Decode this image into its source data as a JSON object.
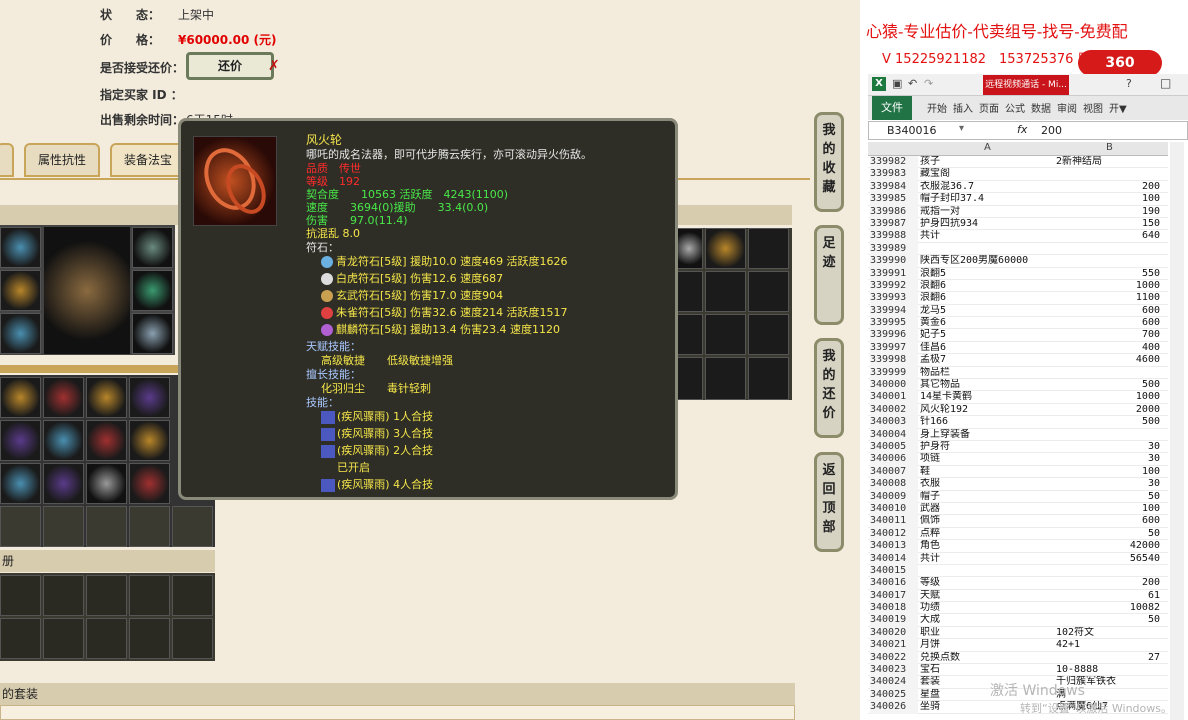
{
  "listing": {
    "status_label": "状　　态：",
    "status_value": "上架中",
    "price_label": "价　　格：",
    "price_value": "¥60000.00 (元)",
    "haggle_label": "是否接受还价：",
    "haggle_button": "还价",
    "buyer_label": "指定买家 ID ：",
    "remaining_label": "出售剩余时间：",
    "remaining_value": "6天15时"
  },
  "tabs": [
    "属性抗性",
    "装备法宝"
  ],
  "section_labels": {
    "s1": "册",
    "s2": "的套装"
  },
  "tooltip": {
    "name": "风火轮",
    "desc": "哪吒的成名法器，即可代步腾云疾行，亦可滚动异火伤敌。",
    "quality": "品质　传世",
    "level": "等级　192",
    "stat1": "契合度　　10563 活跃度　4243(1100)",
    "stat2": "速度　　3694(0)援助　　33.4(0.0)",
    "stat3": "伤害　　97.0(11.4)",
    "stat4": "抗混乱 8.0",
    "runes_label": "符石：",
    "runes": [
      "青龙符石[5级] 援助10.0 速度469 活跃度1626",
      "白虎符石[5级] 伤害12.6 速度687",
      "玄武符石[5级] 伤害17.0 速度904",
      "朱雀符石[5级] 伤害32.6 速度214 活跃度1517",
      "麒麟符石[5级] 援助13.4 伤害23.4 速度1120"
    ],
    "talent_label": "天赋技能：",
    "talent_values": "高级敏捷　　低级敏捷增强",
    "specialty_label": "擅长技能：",
    "specialty_values": "化羽归尘　　毒针轻刺",
    "skills_label": "技能：",
    "skills": [
      "(疾风骤雨) 1人合技",
      "(疾风骤雨) 3人合技",
      "(疾风骤雨) 2人合技",
      "已开启",
      "(疾风骤雨) 4人合技"
    ]
  },
  "side_buttons": [
    "我的收藏",
    "足迹",
    "我的还价",
    "返回顶部"
  ],
  "banner": {
    "line1": "心猿-专业估价-代卖组号-找号-免费配",
    "line2": "V 15225921182　153725376 朋友区组号"
  },
  "excel": {
    "file_menu": "文件",
    "ribbon_tabs": [
      "开始",
      "插入",
      "页面",
      "公式",
      "数据",
      "审阅",
      "视图",
      "开▼"
    ],
    "cell_ref": "B340016",
    "fx": "fx",
    "formula_value": "200",
    "col_a": "A",
    "col_b": "B",
    "window_tab": "远程视频通话 - Mi...",
    "logo": "360",
    "rows": [
      [
        "339982",
        "孩子",
        "2新神结局"
      ],
      [
        "339983",
        "藏宝阁",
        ""
      ],
      [
        "339984",
        "衣服混36.7",
        "200"
      ],
      [
        "339985",
        "帽子封印37.4",
        "100"
      ],
      [
        "339986",
        "戒指一对",
        "190"
      ],
      [
        "339987",
        "护身四抗934",
        "150"
      ],
      [
        "339988",
        "共计",
        "640"
      ],
      [
        "339989",
        "",
        ""
      ],
      [
        "339990",
        "陕西专区200男魔60000",
        ""
      ],
      [
        "339991",
        "浪翻5",
        "550"
      ],
      [
        "339992",
        "浪翻6",
        "1000"
      ],
      [
        "339993",
        "浪翻6",
        "1100"
      ],
      [
        "339994",
        "龙马5",
        "600"
      ],
      [
        "339995",
        "黄金6",
        "600"
      ],
      [
        "339996",
        "妃子5",
        "700"
      ],
      [
        "339997",
        "佳昌6",
        "400"
      ],
      [
        "339998",
        "孟极7",
        "4600"
      ],
      [
        "339999",
        "物品栏",
        ""
      ],
      [
        "340000",
        "其它物品",
        "500"
      ],
      [
        "340001",
        "14星卡黄鹤",
        "1000"
      ],
      [
        "340002",
        "风火轮192",
        "2000"
      ],
      [
        "340003",
        "针166",
        "500"
      ],
      [
        "340004",
        "身上穿装备",
        ""
      ],
      [
        "340005",
        "护身符",
        "30"
      ],
      [
        "340006",
        "项链",
        "30"
      ],
      [
        "340007",
        "鞋",
        "100"
      ],
      [
        "340008",
        "衣服",
        "30"
      ],
      [
        "340009",
        "帽子",
        "50"
      ],
      [
        "340010",
        "武器",
        "100"
      ],
      [
        "340011",
        "佩饰",
        "600"
      ],
      [
        "340012",
        "点粹",
        "50"
      ],
      [
        "340013",
        "角色",
        "42000"
      ],
      [
        "340014",
        "共计",
        "56540"
      ],
      [
        "340015",
        "",
        ""
      ],
      [
        "340016",
        "等级",
        "200"
      ],
      [
        "340017",
        "天赋",
        "61"
      ],
      [
        "340018",
        "功绩",
        "10082"
      ],
      [
        "340019",
        "大成",
        "50"
      ],
      [
        "340020",
        "职业",
        "102符文"
      ],
      [
        "340021",
        "月饼",
        "42+1"
      ],
      [
        "340022",
        "兑换点数",
        "27"
      ],
      [
        "340023",
        "宝石",
        "10-8888"
      ],
      [
        "340024",
        "套装",
        "千归簇军铁衣"
      ],
      [
        "340025",
        "星盘",
        "满"
      ],
      [
        "340026",
        "坐骑",
        "点满魔6仙7"
      ]
    ]
  },
  "watermark": {
    "line1": "激活 Windows",
    "line2": "转到“设置”以激活 Windows。"
  }
}
